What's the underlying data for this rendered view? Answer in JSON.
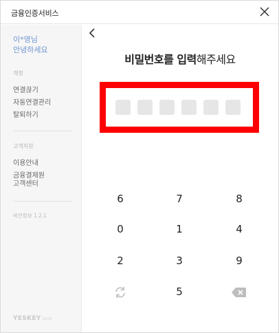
{
  "window": {
    "title": "금융인증서비스"
  },
  "sidebar": {
    "user_line1": "이*영님",
    "user_line2": "안녕하세요",
    "section1_label": "계정",
    "section1_items": [
      "연결끊기",
      "자동연결관리",
      "탈퇴하기"
    ],
    "section2_label": "고객지원",
    "section2_items": [
      "이용안내",
      "금융결제원\n고객센터"
    ],
    "version": "버전정보 1.2.1",
    "brand": "YESKEY",
    "brand_sub": "2019"
  },
  "main": {
    "prompt_bold": "비밀번호를 입력",
    "prompt_rest": "해주세요",
    "pin_length": 6,
    "pin_filled": 0
  },
  "keypad": {
    "rows": [
      [
        "6",
        "7",
        "8"
      ],
      [
        "0",
        "1",
        "4"
      ],
      [
        "2",
        "3",
        "9"
      ],
      [
        "refresh-icon",
        "5",
        "backspace-icon"
      ]
    ]
  },
  "colors": {
    "accent_user": "#6f96d4",
    "highlight": "#ff0000",
    "pin_empty": "#e6e6e6"
  }
}
